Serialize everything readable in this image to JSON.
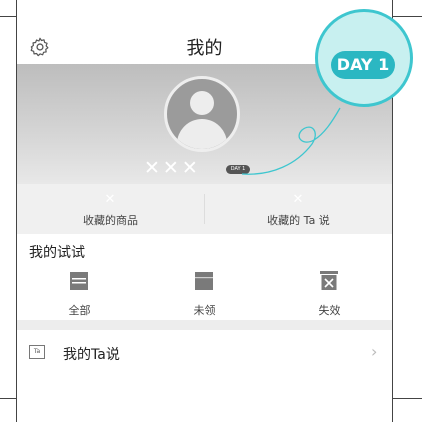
{
  "header": {
    "title": "我的",
    "settings_icon": "gear-icon"
  },
  "profile": {
    "name": "✕✕✕",
    "day_small": "DAY 1"
  },
  "favorites": [
    {
      "icon": "✕",
      "label": "收藏的商品"
    },
    {
      "icon": "✕",
      "label": "收藏的 Ta 说"
    }
  ],
  "tries": {
    "title": "我的试试",
    "items": [
      {
        "icon": "all-icon",
        "label": "全部"
      },
      {
        "icon": "unclaimed-icon",
        "label": "未领"
      },
      {
        "icon": "expired-icon",
        "label": "失效"
      }
    ]
  },
  "ta_row": {
    "icon_text": "Ta",
    "label": "我的Ta说",
    "arrow": "›"
  },
  "callout": {
    "label": "DAY 1"
  },
  "colors": {
    "accent": "#2bb7c2",
    "banner": "#c8c8c8"
  }
}
